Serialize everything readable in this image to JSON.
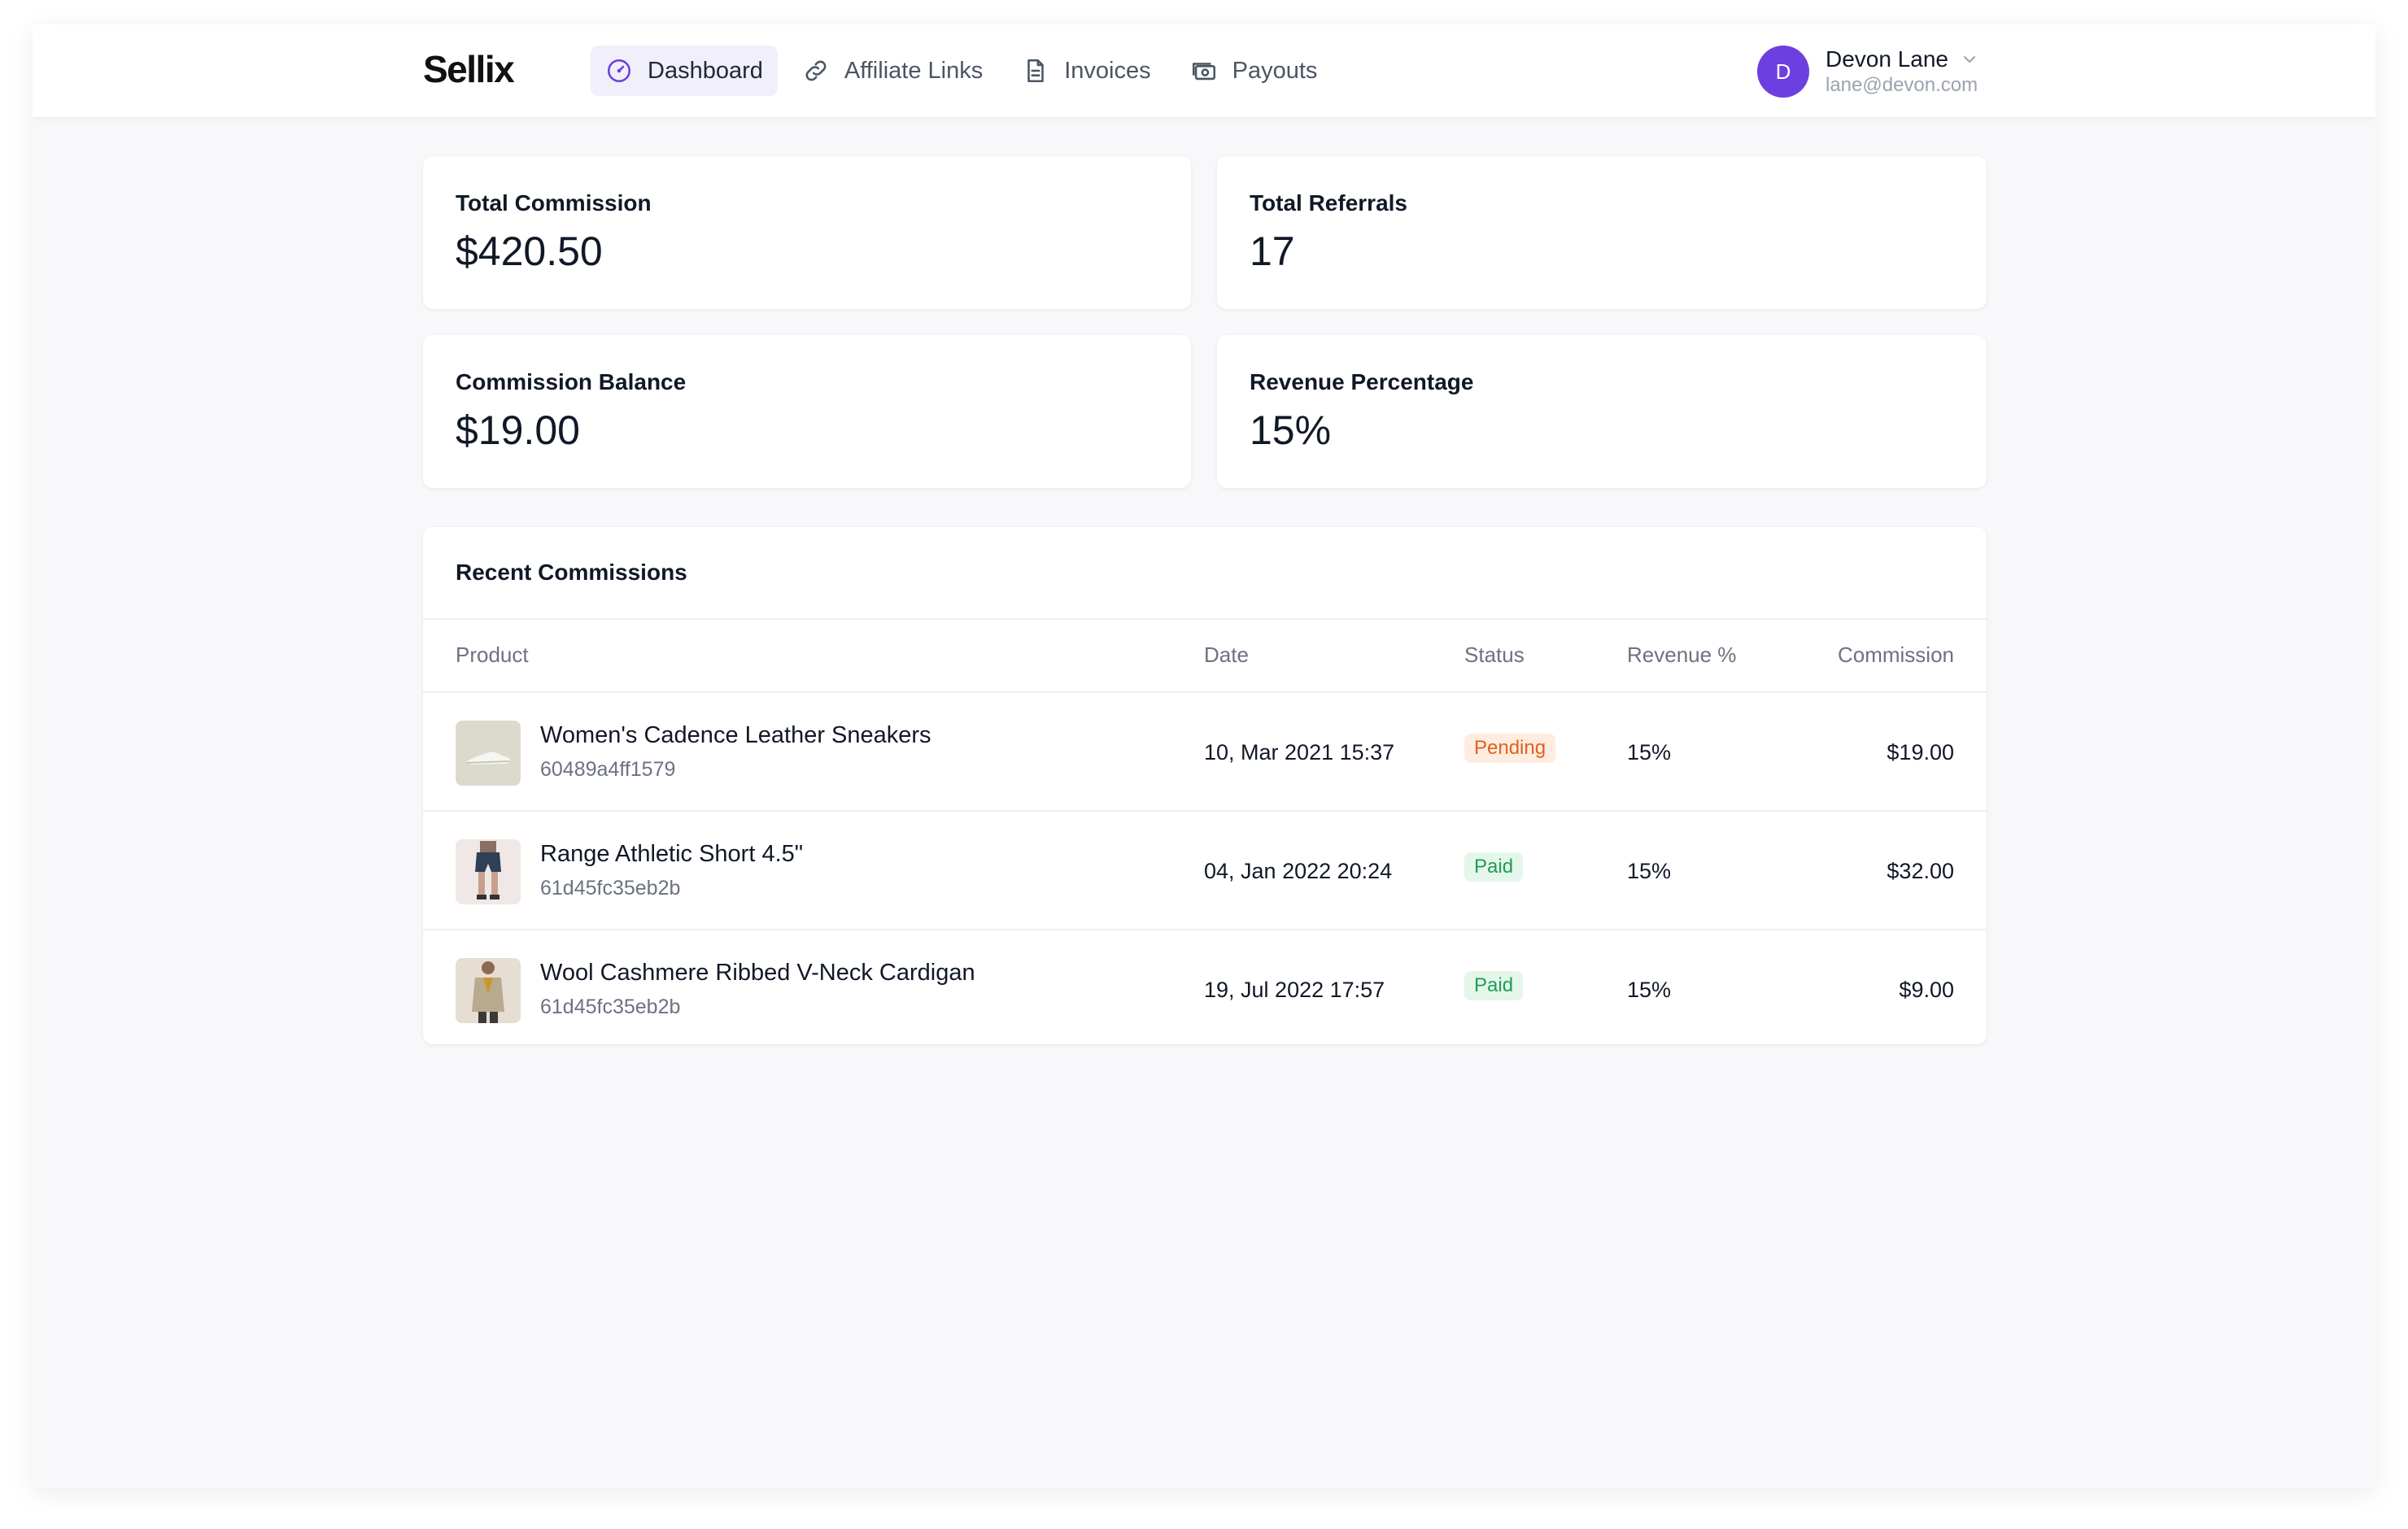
{
  "brand": {
    "name": "Sellix"
  },
  "nav": {
    "items": [
      {
        "label": "Dashboard",
        "icon": "dashboard-gauge-icon",
        "active": true
      },
      {
        "label": "Affiliate Links",
        "icon": "link-icon",
        "active": false
      },
      {
        "label": "Invoices",
        "icon": "document-icon",
        "active": false
      },
      {
        "label": "Payouts",
        "icon": "cash-icon",
        "active": false
      }
    ]
  },
  "user": {
    "initial": "D",
    "name": "Devon Lane",
    "email": "lane@devon.com",
    "avatar_color": "#6d3fe0"
  },
  "stats": [
    {
      "label": "Total Commission",
      "value": "$420.50"
    },
    {
      "label": "Total Referrals",
      "value": "17"
    },
    {
      "label": "Commission Balance",
      "value": "$19.00"
    },
    {
      "label": "Revenue Percentage",
      "value": "15%"
    }
  ],
  "commissions": {
    "title": "Recent Commissions",
    "columns": [
      "Product",
      "Date",
      "Status",
      "Revenue %",
      "Commission"
    ],
    "rows": [
      {
        "product": "Women's Cadence Leather Sneakers",
        "id": "60489a4ff1579",
        "date": "10, Mar 2021 15:37",
        "status": "Pending",
        "revenue": "15%",
        "commission": "$19.00"
      },
      {
        "product": "Range Athletic Short 4.5\"",
        "id": "61d45fc35eb2b",
        "date": "04, Jan 2022 20:24",
        "status": "Paid",
        "revenue": "15%",
        "commission": "$32.00"
      },
      {
        "product": "Wool Cashmere Ribbed V-Neck Cardigan",
        "id": "61d45fc35eb2b",
        "date": "19, Jul 2022 17:57",
        "status": "Paid",
        "revenue": "15%",
        "commission": "$9.00"
      }
    ]
  },
  "colors": {
    "accent": "#6d3fe0",
    "pending": "#e0611e",
    "paid": "#1f9d55"
  }
}
